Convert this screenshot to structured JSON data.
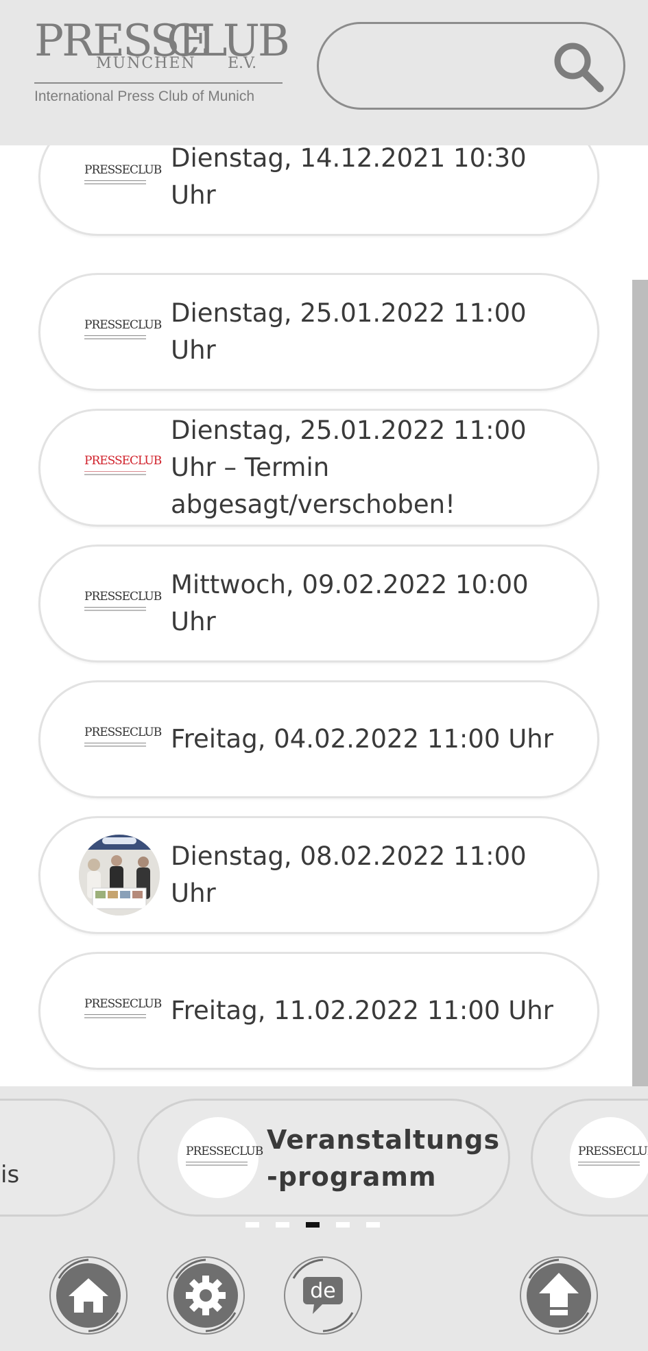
{
  "header": {
    "logo": {
      "presse": "PRESSE",
      "club": "CLUB",
      "muenchen": "MÜNCHEN",
      "ev": "E.V.",
      "tagline": "International Press Club of Munich"
    },
    "search": {
      "placeholder": "",
      "icon": "search-icon"
    }
  },
  "events": [
    {
      "label": "Dienstag, 14.12.2021 10:30 Uhr",
      "thumb": "presseclub-logo"
    },
    {
      "label": "Dienstag, 25.01.2022 11:00 Uhr",
      "thumb": "presseclub-logo"
    },
    {
      "label": "Dienstag, 25.01.2022 11:00 Uhr – Termin abgesagt/verschoben!",
      "thumb": "presseclub-logo-red"
    },
    {
      "label": "Mittwoch, 09.02.2022 10:00 Uhr",
      "thumb": "presseclub-logo"
    },
    {
      "label": "Freitag, 04.02.2022 11:00 Uhr",
      "thumb": "presseclub-logo"
    },
    {
      "label": "Dienstag, 08.02.2022 11:00 Uhr",
      "thumb": "event-photo"
    },
    {
      "label": "Freitag, 11.02.2022 11:00 Uhr",
      "thumb": "presseclub-logo"
    }
  ],
  "carousel": {
    "left_partial_text": "is",
    "center_title": "Veranstaltungs\n-programm",
    "page_count": 5,
    "active_page": 3
  },
  "mini_logo_text": "PRESSECLUB",
  "nav": {
    "home_icon": "home-icon",
    "settings_icon": "gear-icon",
    "language_label": "de",
    "up_icon": "arrow-up-icon"
  },
  "colors": {
    "header_bg": "#e7e7e7",
    "accent_gray": "#7d7d7d",
    "cancel_logo_red": "#d0202a",
    "active_dot": "#111111"
  }
}
